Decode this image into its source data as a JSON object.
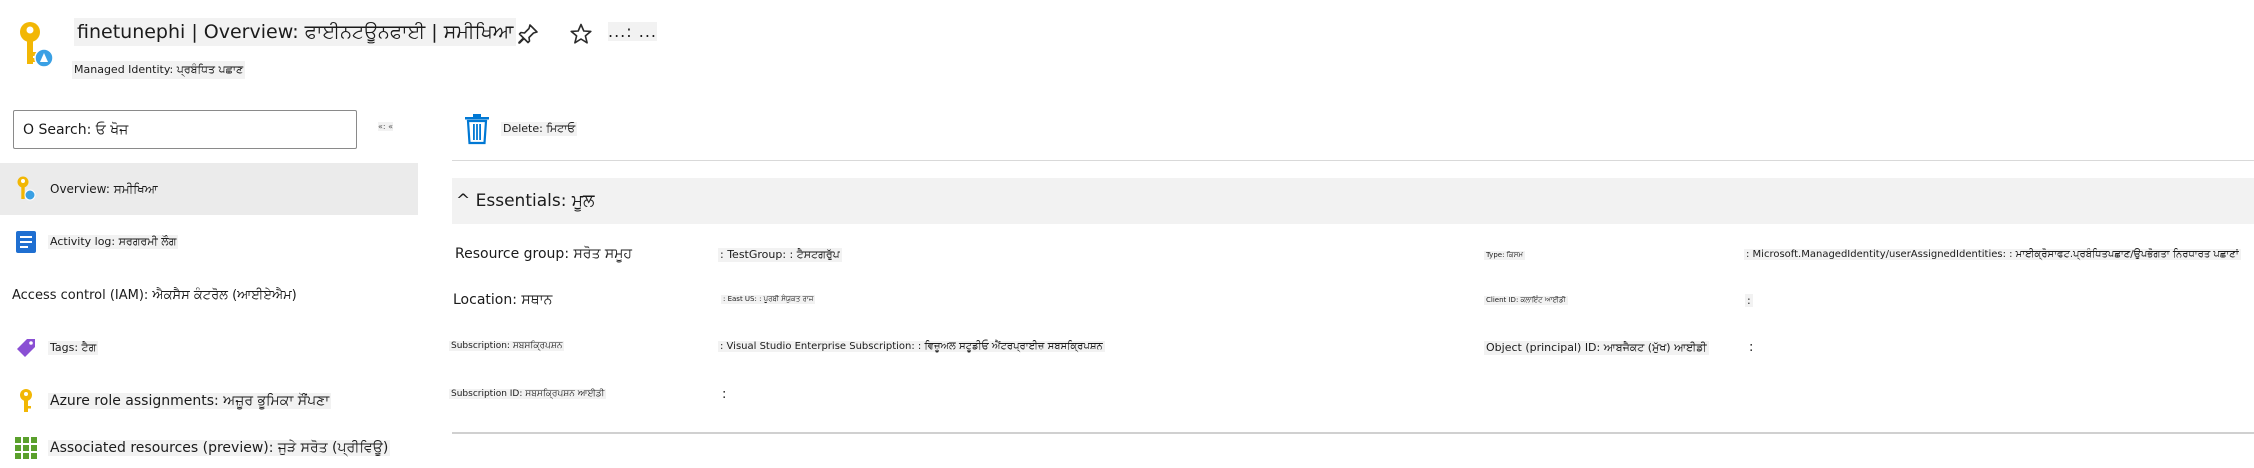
{
  "header": {
    "title": "finetunephi | Overview: ਫਾਈਨਟਊਨਫਾਈ | ਸਮੀਖਿਆ",
    "subtitle": "Managed Identity: ਪ੍ਰਬੰਧਿਤ ਪਛਾਣ",
    "more_label": "...: ...",
    "icons": [
      "managed-identity-key-icon",
      "pin-icon",
      "star-icon"
    ]
  },
  "sidebar": {
    "search_label": "O Search: ਓ ਖੋਜ",
    "collapse_label": "«: «",
    "items": [
      {
        "label": "Overview: ਸਮੀਖਿਆ",
        "icon": "managed-identity-key-icon",
        "selected": true
      },
      {
        "label": "Activity log: ਸਰਗਰਮੀ ਲੌਗ",
        "icon": "activity-log-icon"
      },
      {
        "label": "Access control (IAM): ਐਕਸੈਸ ਕੰਟਰੋਲ (ਆਈਏਐਮ)",
        "icon": ""
      },
      {
        "label": "Tags: ਟੈਗ",
        "icon": "tag-icon"
      },
      {
        "label": "Azure role assignments: ਅਜ਼ੂਰ ਭੂਮਿਕਾ ਸੌਂਪਣਾ",
        "icon": "key-icon"
      },
      {
        "label": "Associated resources (preview): ਜੁੜੇ ਸਰੋਤ (ਪ੍ਰੀਵਿਊ)",
        "icon": "grid-icon"
      }
    ]
  },
  "toolbar": {
    "delete_label": "Delete: ਮਿਟਾਓ"
  },
  "essentials": {
    "title": "^ Essentials: ਮੂਲ",
    "left": [
      {
        "label": "Resource group: ਸਰੋਤ ਸਮੂਹ",
        "value": ": TestGroup: : ਟੈਸਟਗਰੁੱਪ"
      },
      {
        "label": "Location: ਸਥਾਨ",
        "value": ": East US: : ਪੂਰਬੀ ਸੰਯੁਕਤ ਰਾਜ"
      },
      {
        "label": "Subscription: ਸਬਸਕ੍ਰਿਪਸ਼ਨ",
        "value": ": Visual Studio Enterprise Subscription: : ਵਿਜ਼ੂਅਲ ਸਟੂਡੀਓ ਐਂਟਰਪ੍ਰਾਈਜ਼ ਸਬਸਕ੍ਰਿਪਸ਼ਨ"
      },
      {
        "label": "Subscription ID: ਸਬਸਕ੍ਰਿਪਸ਼ਨ ਆਈਡੀ",
        "value": ":"
      }
    ],
    "right": [
      {
        "label": "Type: ਕਿਸਮ",
        "value": ": Microsoft.ManagedIdentity/userAssignedIdentities: : ਮਾਈਕ੍ਰੋਸਾਫਟ.ਪ੍ਰਬੰਧਿਤਪਛਾਣ/ਉਪਭੋਗਤਾ ਨਿਰਧਾਰਤ ਪਛਾਣਾਂ"
      },
      {
        "label": "Client ID: ਕਲਾਇੰਟ ਆਈਡੀ",
        "value": ":"
      },
      {
        "label": "Object (principal) ID: ਆਬਜੈਕਟ (ਮੁੱਖ) ਆਈਡੀ",
        "value": ":"
      }
    ]
  },
  "colors": {
    "accent": "#0078d4",
    "key_yellow": "#f2b705",
    "tag_purple": "#8a4fd4",
    "grid_green": "#5aa02c"
  }
}
